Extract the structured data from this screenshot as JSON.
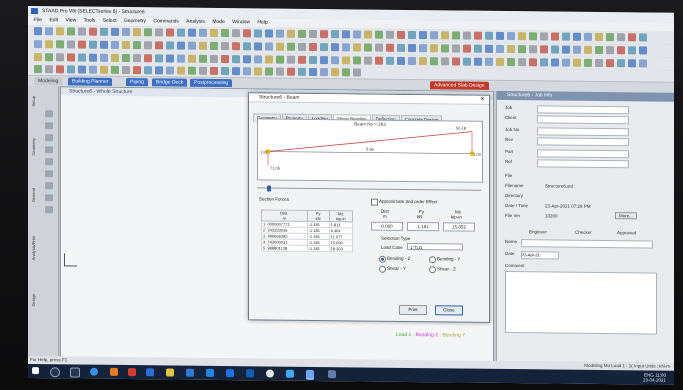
{
  "window": {
    "title": "STAAD.Pro V8i (SELECTseries 6) - Structure6"
  },
  "menu": [
    "File",
    "Edit",
    "View",
    "Tools",
    "Select",
    "Geometry",
    "Commands",
    "Analysis",
    "Mode",
    "Window",
    "Help"
  ],
  "page_tabs": [
    {
      "label": "Modeling",
      "color": "#c7cbd1"
    },
    {
      "label": "Building Planner",
      "color": "#3a6fc4"
    },
    {
      "label": "Piping",
      "color": "#3a6fc4"
    },
    {
      "label": "Bridge Deck",
      "color": "#3a6fc4"
    },
    {
      "label": "Postprocessing",
      "color": "#3a6fc4"
    },
    {
      "label": "Advanced Slab Design",
      "color": "#c0392b"
    }
  ],
  "left_tabs": [
    "Setup",
    "Geometry",
    "General",
    "Analysis/Print",
    "Design"
  ],
  "canvas": {
    "title": "Structure6 - Whole Structure"
  },
  "load_indicator": {
    "prefix": "Load 1 : ",
    "bending": "Bending Z",
    "sep": " : ",
    "extra": "Bending Y"
  },
  "right_panel": {
    "title": "Structure6 - Job Info",
    "fields": [
      "Job",
      "Client",
      "Job No",
      "Rev",
      "Part",
      "Ref"
    ],
    "file_label": "File",
    "filename_label": "Filename",
    "filename": "Structure6.std",
    "directory_label": "Directory",
    "datetime_label": "Date / Time",
    "datetime": "23-Apr-2021 07:28 PM",
    "fileversion_label": "File Ver",
    "fileversion": "10200",
    "more_button": "More...",
    "engineer": "Engineer",
    "checker": "Checker",
    "approved": "Approved",
    "name_label": "Name",
    "date_label": "Date",
    "date_value": "23-Apr-21",
    "comment_label": "Comment"
  },
  "status": {
    "left": "For Help, press F1",
    "right": "Modeling Mo  Load 1 : 1(  Input Units : kN-m"
  },
  "taskbar": {
    "time": "11:00",
    "date": "23-04-2021",
    "lang": "ENG"
  },
  "dialog": {
    "title": "Structure6 - Beam",
    "tabs": [
      "Geometry",
      "Property",
      "Loading",
      "Shear Bending",
      "Deflection",
      "Concrete Design"
    ],
    "active_tab": 3,
    "beam_no": "Beam No = 263",
    "section_forces_label": "Section Forces",
    "table_headers": [
      [
        "Dist.",
        "m"
      ],
      [
        "Fy",
        "kN"
      ],
      [
        "Mz",
        "kip-in"
      ]
    ],
    "table_rows": [
      [
        "1  .0000007771",
        "-1.181",
        "1.811"
      ],
      [
        "2  .243333036",
        "-1.181",
        "6.464"
      ],
      [
        "3  .486666393",
        "-1.181",
        "11.077"
      ],
      [
        "4  .743000031",
        "-1.181",
        "15.690"
      ],
      [
        "5  .988801138",
        "-1.181",
        "18.303"
      ]
    ],
    "approx_label": "Approximate 2nd order Effect",
    "dist_label": "Dist",
    "dist_unit": "m",
    "fy_label": "Fy",
    "fy_unit": "kN",
    "mz_label": "Mz",
    "mz_unit": "kip-in",
    "dist_value": "0.000",
    "fy_value": "1.181",
    "mz_value": "15.052",
    "selection_type_label": "Selection Type",
    "load_case_label": "Load Case",
    "load_case_value": "1:TLD",
    "bending_z": "Bending - Z",
    "bending_y": "Bending - Y",
    "shear_y": "Shear - Y",
    "shear_z": "Shear - Z",
    "print_button": "Print",
    "close_button": "Close",
    "diagram": {
      "left_value": "1.81",
      "mid_value": "5.66",
      "right_value": "1.03",
      "top_right_value": "56.18",
      "low_left_value": "71.05"
    }
  }
}
